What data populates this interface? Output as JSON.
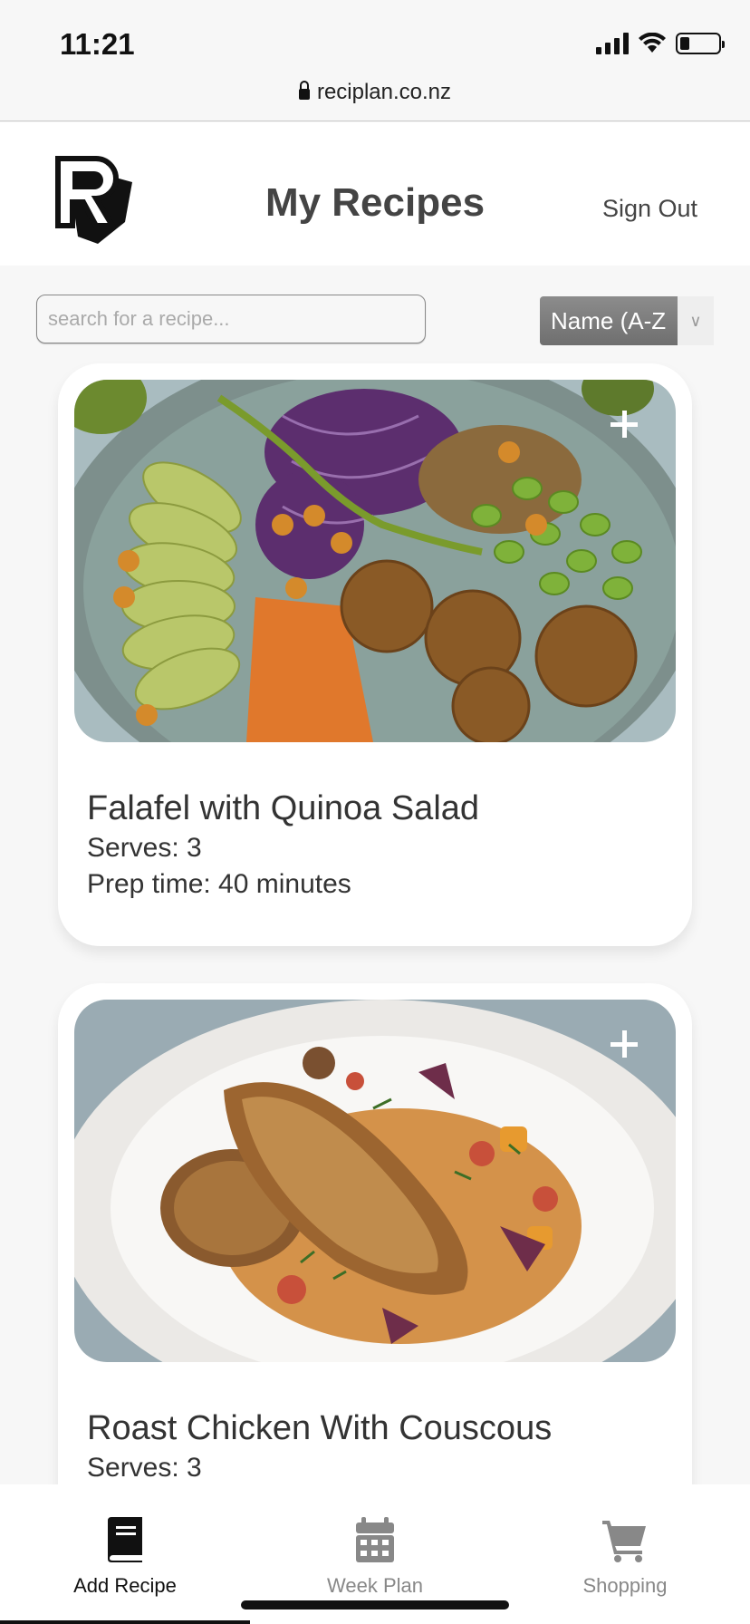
{
  "status_bar": {
    "time": "11:21",
    "battery_level": 0.25,
    "url": "reciplan.co.nz"
  },
  "header": {
    "logo_icon": "reciplan-r-logo-icon",
    "title": "My Recipes",
    "sign_out_label": "Sign Out"
  },
  "search": {
    "placeholder": "search for a recipe...",
    "value": ""
  },
  "sort": {
    "selected": "Name (A-Z"
  },
  "recipes": [
    {
      "title": "Falafel with Quinoa Salad",
      "serves": "Serves: 3",
      "prep_time": "Prep time: 40 minutes"
    },
    {
      "title": "Roast Chicken With Couscous",
      "serves": "Serves: 3"
    }
  ],
  "tab_bar": {
    "tabs": [
      {
        "label": "Add Recipe",
        "icon": "book-icon",
        "active": true
      },
      {
        "label": "Week Plan",
        "icon": "calendar-icon",
        "active": false
      },
      {
        "label": "Shopping",
        "icon": "cart-icon",
        "active": false
      }
    ]
  },
  "colors": {
    "background": "#f7f7f7",
    "card": "#ffffff",
    "text": "#333333",
    "tab_active": "#111111",
    "tab_inactive": "#888888"
  }
}
